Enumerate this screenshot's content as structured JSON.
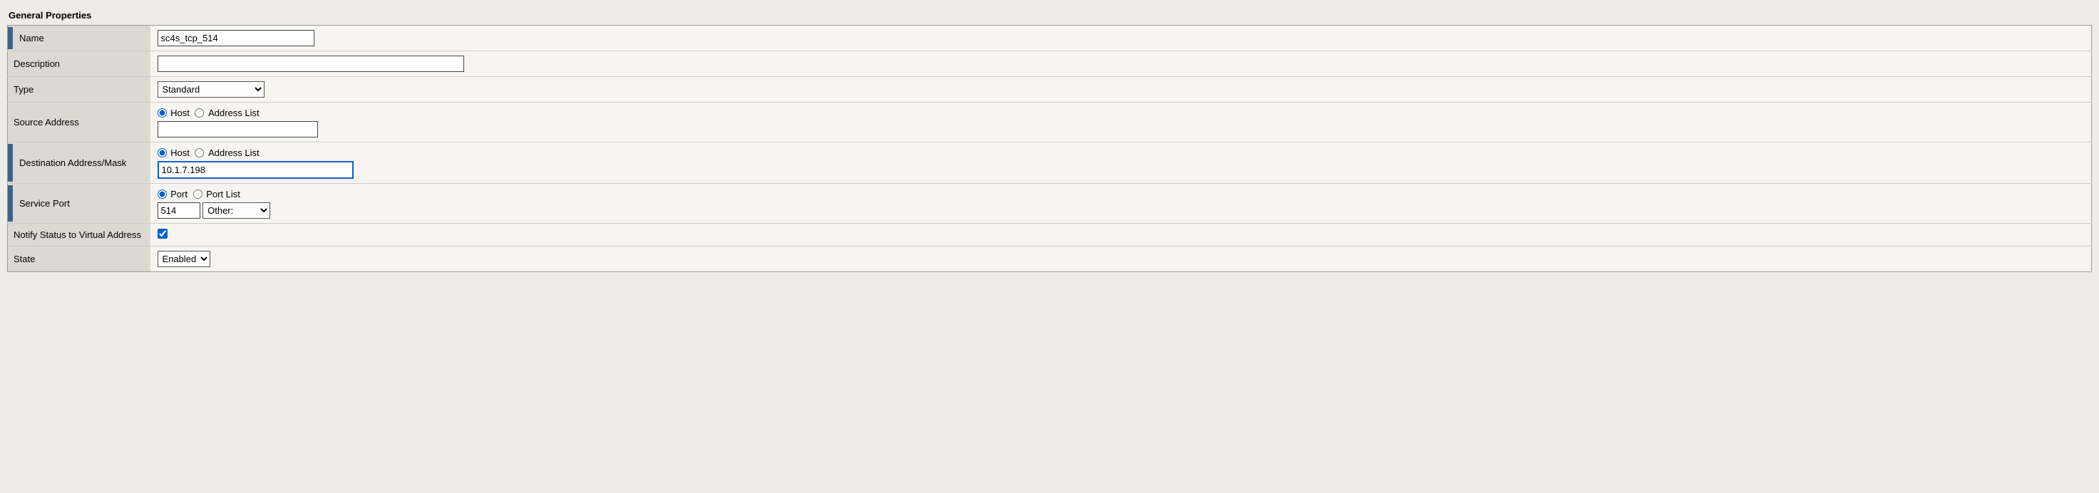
{
  "section_title": "General Properties",
  "rows": {
    "name": {
      "label": "Name",
      "value": "sc4s_tcp_514"
    },
    "description": {
      "label": "Description",
      "value": ""
    },
    "type": {
      "label": "Type",
      "options": [
        "Standard"
      ],
      "selected": "Standard"
    },
    "source_address": {
      "label": "Source Address",
      "radio_host": "Host",
      "radio_list": "Address List",
      "selected": "host",
      "value": ""
    },
    "destination": {
      "label": "Destination Address/Mask",
      "radio_host": "Host",
      "radio_list": "Address List",
      "selected": "host",
      "value": "10.1.7.198"
    },
    "service_port": {
      "label": "Service Port",
      "radio_port": "Port",
      "radio_list": "Port List",
      "selected": "port",
      "value": "514",
      "other_label": "Other:",
      "other_options": [
        "Other:"
      ]
    },
    "notify": {
      "label": "Notify Status to Virtual Address",
      "checked": true
    },
    "state": {
      "label": "State",
      "options": [
        "Enabled"
      ],
      "selected": "Enabled"
    }
  }
}
